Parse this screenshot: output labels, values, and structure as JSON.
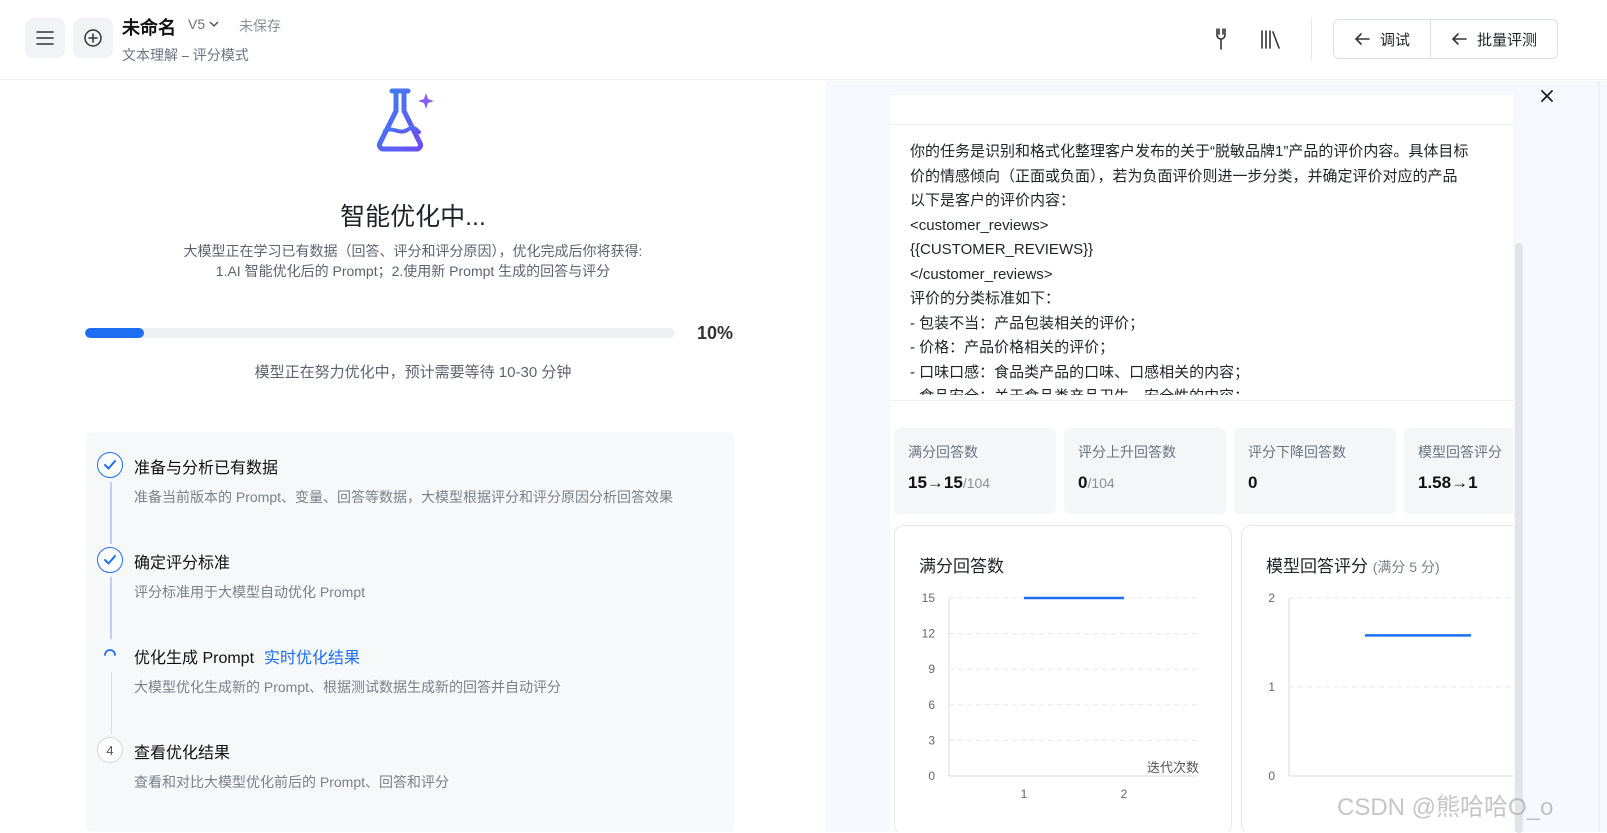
{
  "header": {
    "title": "未命名",
    "version": "V5",
    "status": "未保存",
    "subtitle": "文本理解 ⎯ 评分模式",
    "debug_label": "调试",
    "batch_label": "批量评测"
  },
  "optimize": {
    "title": "智能优化中...",
    "desc_line1": "大模型正在学习已有数据（回答、评分和评分原因），优化完成后你将获得:",
    "desc_line2": "1.AI 智能优化后的 Prompt；2.使用新 Prompt 生成的回答与评分",
    "progress": 0.1,
    "progress_label": "10%",
    "wait_text": "模型正在努力优化中，预计需要等待 10-30 分钟"
  },
  "steps": [
    {
      "title": "准备与分析已有数据",
      "desc": "准备当前版本的 Prompt、变量、回答等数据，大模型根据评分和评分原因分析回答效果",
      "state": "done"
    },
    {
      "title": "确定评分标准",
      "desc": "评分标准用于大模型自动优化 Prompt",
      "state": "done"
    },
    {
      "title": "优化生成 Prompt",
      "link": "实时优化结果",
      "desc": "大模型优化生成新的 Prompt、根据测试数据生成新的回答并自动评分",
      "state": "running"
    },
    {
      "title": "查看优化结果",
      "desc": "查看和对比大模型优化前后的 Prompt、回答和评分",
      "state": "pending",
      "num": "4"
    }
  ],
  "prompt_lines": [
    "你的任务是识别和格式化整理客户发布的关于“脱敏品牌1”产品的评价内容。具体目标",
    "价的情感倾向（正面或负面），若为负面评价则进一步分类，并确定评价对应的产品",
    "以下是客户的评价内容：",
    "<customer_reviews>",
    "{{CUSTOMER_REVIEWS}}",
    "</customer_reviews>",
    "评价的分类标准如下：",
    "- 包装不当：产品包装相关的评价；",
    "- 价格：产品价格相关的评价；",
    "- 口味口感：食品类产品的口味、口感相关的内容；",
    "- 食品安全：关于食品类产品卫生、安全性的内容；"
  ],
  "stats": [
    {
      "label": "满分回答数",
      "value": "15→15",
      "denom": "/104"
    },
    {
      "label": "评分上升回答数",
      "value": "0",
      "denom": "/104"
    },
    {
      "label": "评分下降回答数",
      "value": "0",
      "denom": ""
    },
    {
      "label": "模型回答评分",
      "value": "1.58→1",
      "denom": ""
    }
  ],
  "chart_data": [
    {
      "type": "line",
      "title": "满分回答数",
      "xlabel": "迭代次数",
      "ylabel": "",
      "x": [
        1,
        2
      ],
      "series": [
        {
          "values": [
            15,
            15
          ]
        }
      ],
      "ylim": [
        0,
        15
      ],
      "yticks": [
        0,
        3,
        6,
        9,
        12,
        15
      ],
      "xticks": [
        1,
        2
      ],
      "grid": true
    },
    {
      "type": "line",
      "title": "模型回答评分",
      "subtitle": "(满分 5 分)",
      "x": [
        1,
        2
      ],
      "series": [
        {
          "values": [
            1.58,
            1.58
          ]
        }
      ],
      "ylim": [
        0,
        2
      ],
      "yticks": [
        0,
        1,
        2
      ],
      "grid": true
    }
  ],
  "colors": {
    "accent": "#1d6ef0",
    "track": "#eef0f4"
  },
  "watermark": "CSDN @熊哈哈O_o"
}
